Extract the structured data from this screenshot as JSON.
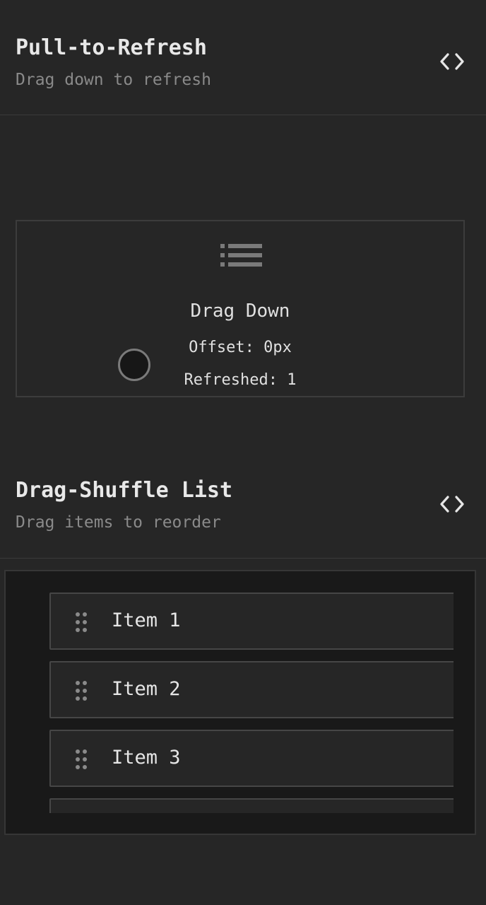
{
  "pull_to_refresh": {
    "title": "Pull-to-Refresh",
    "subtitle": "Drag down to refresh",
    "code_icon": "code-brackets-icon",
    "list_icon": "list-icon",
    "label": "Drag Down",
    "offset": "Offset: 0px",
    "refreshed": "Refreshed: 1"
  },
  "drag_shuffle": {
    "title": "Drag-Shuffle List",
    "subtitle": "Drag items to reorder",
    "code_icon": "code-brackets-icon",
    "grip_icon": "drag-grip-icon",
    "items": [
      {
        "label": "Item 1"
      },
      {
        "label": "Item 2"
      },
      {
        "label": "Item 3"
      },
      {
        "label": ""
      }
    ]
  },
  "colors": {
    "background": "#262626",
    "panel": "#191919",
    "border": "#464646",
    "muted_text": "#8a8a8a",
    "text": "#e6e6e6"
  }
}
